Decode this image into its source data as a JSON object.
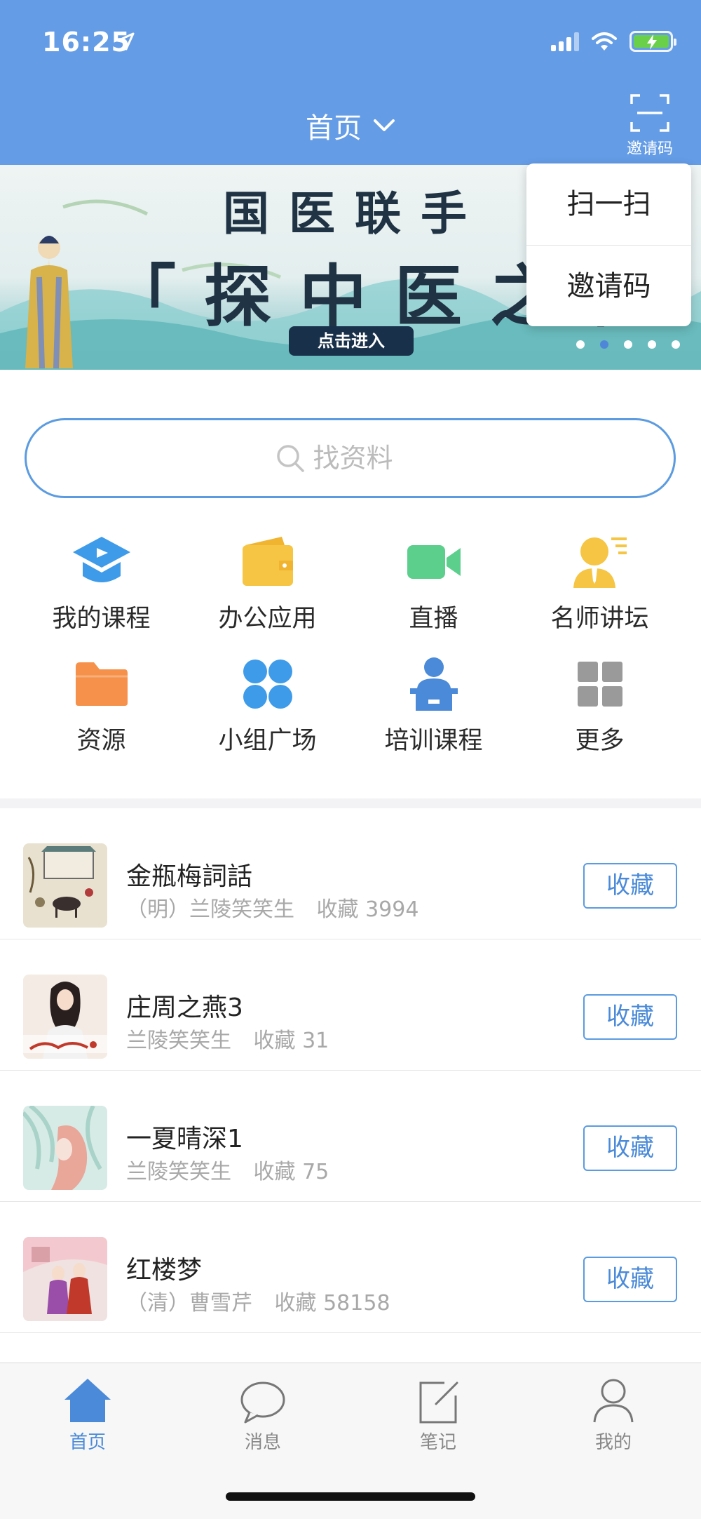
{
  "status_bar": {
    "time": "16:25"
  },
  "header": {
    "title": "首页",
    "scan_caption": "邀请码"
  },
  "popup_menu": {
    "items": [
      "扫一扫",
      "邀请码"
    ]
  },
  "banner": {
    "line1": "国医联手",
    "line2": "「探中医之秘",
    "cta": "点击进入",
    "dot_count": 5,
    "active_dot": 2
  },
  "search": {
    "placeholder": "找资料"
  },
  "grid": {
    "items": [
      {
        "label": "我的课程",
        "icon": "graduation-cap-icon",
        "color": "#3d9be9"
      },
      {
        "label": "办公应用",
        "icon": "wallet-icon",
        "color": "#f5c543"
      },
      {
        "label": "直播",
        "icon": "video-camera-icon",
        "color": "#5ccf8c"
      },
      {
        "label": "名师讲坛",
        "icon": "teacher-icon",
        "color": "#f5c543"
      },
      {
        "label": "资源",
        "icon": "folder-icon",
        "color": "#f5914a"
      },
      {
        "label": "小组广场",
        "icon": "group-icon",
        "color": "#3d9be9"
      },
      {
        "label": "培训课程",
        "icon": "lecturer-icon",
        "color": "#4a8ad8"
      },
      {
        "label": "更多",
        "icon": "more-grid-icon",
        "color": "#9a9a9a"
      }
    ]
  },
  "list": {
    "items": [
      {
        "title": "金瓶梅詞話",
        "author": "（明）兰陵笑笑生",
        "fav_label": "收藏",
        "fav_count": "3994",
        "button": "收藏"
      },
      {
        "title": "庄周之燕3",
        "author": "兰陵笑笑生",
        "fav_label": "收藏",
        "fav_count": "31",
        "button": "收藏"
      },
      {
        "title": "一夏晴深1",
        "author": "兰陵笑笑生",
        "fav_label": "收藏",
        "fav_count": "75",
        "button": "收藏"
      },
      {
        "title": "红楼梦",
        "author": "（清）曹雪芹",
        "fav_label": "收藏",
        "fav_count": "58158",
        "button": "收藏"
      }
    ]
  },
  "tabbar": {
    "items": [
      {
        "label": "首页",
        "icon": "home-icon",
        "active": true
      },
      {
        "label": "消息",
        "icon": "chat-bubble-icon",
        "active": false
      },
      {
        "label": "笔记",
        "icon": "edit-note-icon",
        "active": false
      },
      {
        "label": "我的",
        "icon": "profile-icon",
        "active": false
      }
    ]
  },
  "colors": {
    "header": "#649ce6",
    "accent": "#4a8ad8"
  }
}
